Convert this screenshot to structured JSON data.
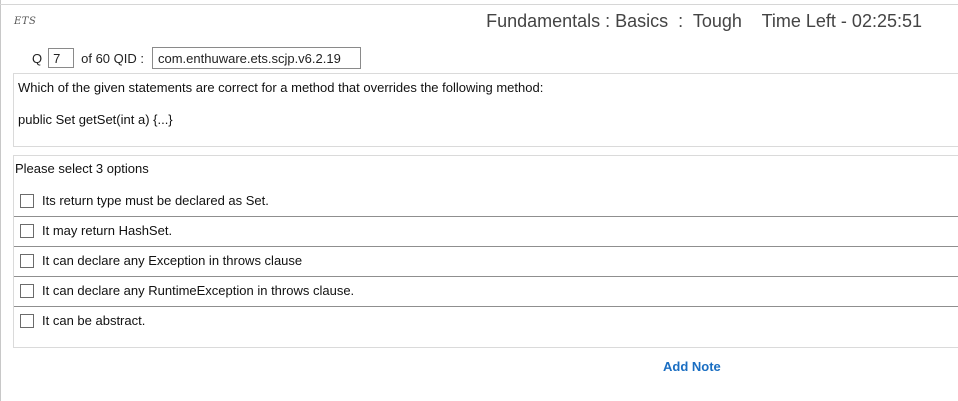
{
  "header": {
    "logo": "ETS",
    "title": "Fundamentals : Basics  :  Tough    Time Left - 02:25:51"
  },
  "question_bar": {
    "q_label": "Q",
    "question_number": "7",
    "of_label": "of 60 QID :",
    "qid": "com.enthuware.ets.scjp.v6.2.19"
  },
  "question": {
    "text": "Which of the given statements are correct for a method that overrides the following method:",
    "code": "public Set getSet(int a) {...}"
  },
  "options": {
    "hint": "Please select 3 options",
    "items": [
      {
        "label": "Its return type must be declared as Set.",
        "checked": false
      },
      {
        "label": "It may return HashSet.",
        "checked": false
      },
      {
        "label": "It can declare any Exception in throws clause",
        "checked": false
      },
      {
        "label": "It can declare any RuntimeException in throws clause.",
        "checked": false
      },
      {
        "label": "It can be abstract.",
        "checked": false
      }
    ]
  },
  "footer": {
    "add_note": "Add Note"
  },
  "colors": {
    "link": "#1a6ec2"
  }
}
